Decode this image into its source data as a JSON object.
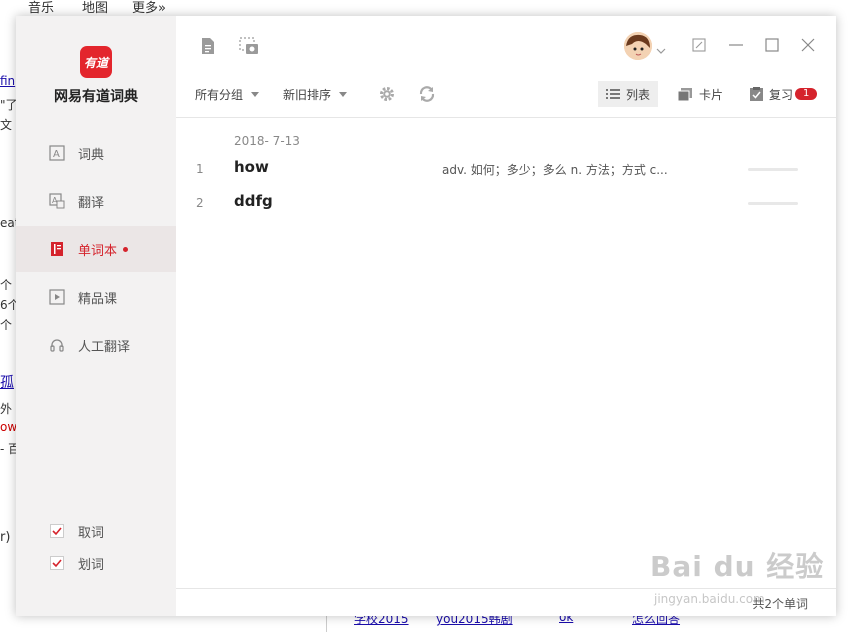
{
  "background": {
    "topnav": [
      "音乐",
      "地图",
      "更多»"
    ],
    "snippets": [
      "fin",
      "\"了",
      "文",
      "eat",
      "个",
      "6个",
      "个",
      "孤",
      "外",
      "ow",
      "- 百",
      "r)"
    ],
    "bottom_links": [
      "学校2015",
      "you2015韩剧",
      "ok",
      "怎么回答"
    ]
  },
  "app": {
    "logo_text": "有道",
    "name": "网易有道词典"
  },
  "sidebar": {
    "nav": [
      {
        "label": "词典"
      },
      {
        "label": "翻译"
      },
      {
        "label": "单词本"
      },
      {
        "label": "精品课"
      },
      {
        "label": "人工翻译"
      }
    ],
    "checks": [
      {
        "label": "取词",
        "checked": true
      },
      {
        "label": "划词",
        "checked": true
      }
    ]
  },
  "filters": {
    "group": "所有分组",
    "sort": "新旧排序"
  },
  "views": {
    "list": "列表",
    "card": "卡片",
    "review": "复习",
    "review_count": "1"
  },
  "wordbook": {
    "date": "2018- 7-13",
    "words": [
      {
        "num": "1",
        "word": "how",
        "def": "adv. 如何；多少；多么  n. 方法；方式  c..."
      },
      {
        "num": "2",
        "word": "ddfg",
        "def": ""
      }
    ],
    "total": "共2个单词"
  },
  "watermark": {
    "main": "Bai du 经验",
    "sub": "jingyan.baidu.com"
  },
  "colors": {
    "accent": "#d5232c",
    "sidebar_bg": "#f3f2f2",
    "active_bg": "#ebe6e6"
  },
  "icons": {
    "note": "note-icon",
    "screenshot": "screenshot-icon",
    "settings": "gear-icon",
    "sync": "sync-icon",
    "minimize": "minimize-icon",
    "maximize": "maximize-icon",
    "close": "close-icon"
  }
}
